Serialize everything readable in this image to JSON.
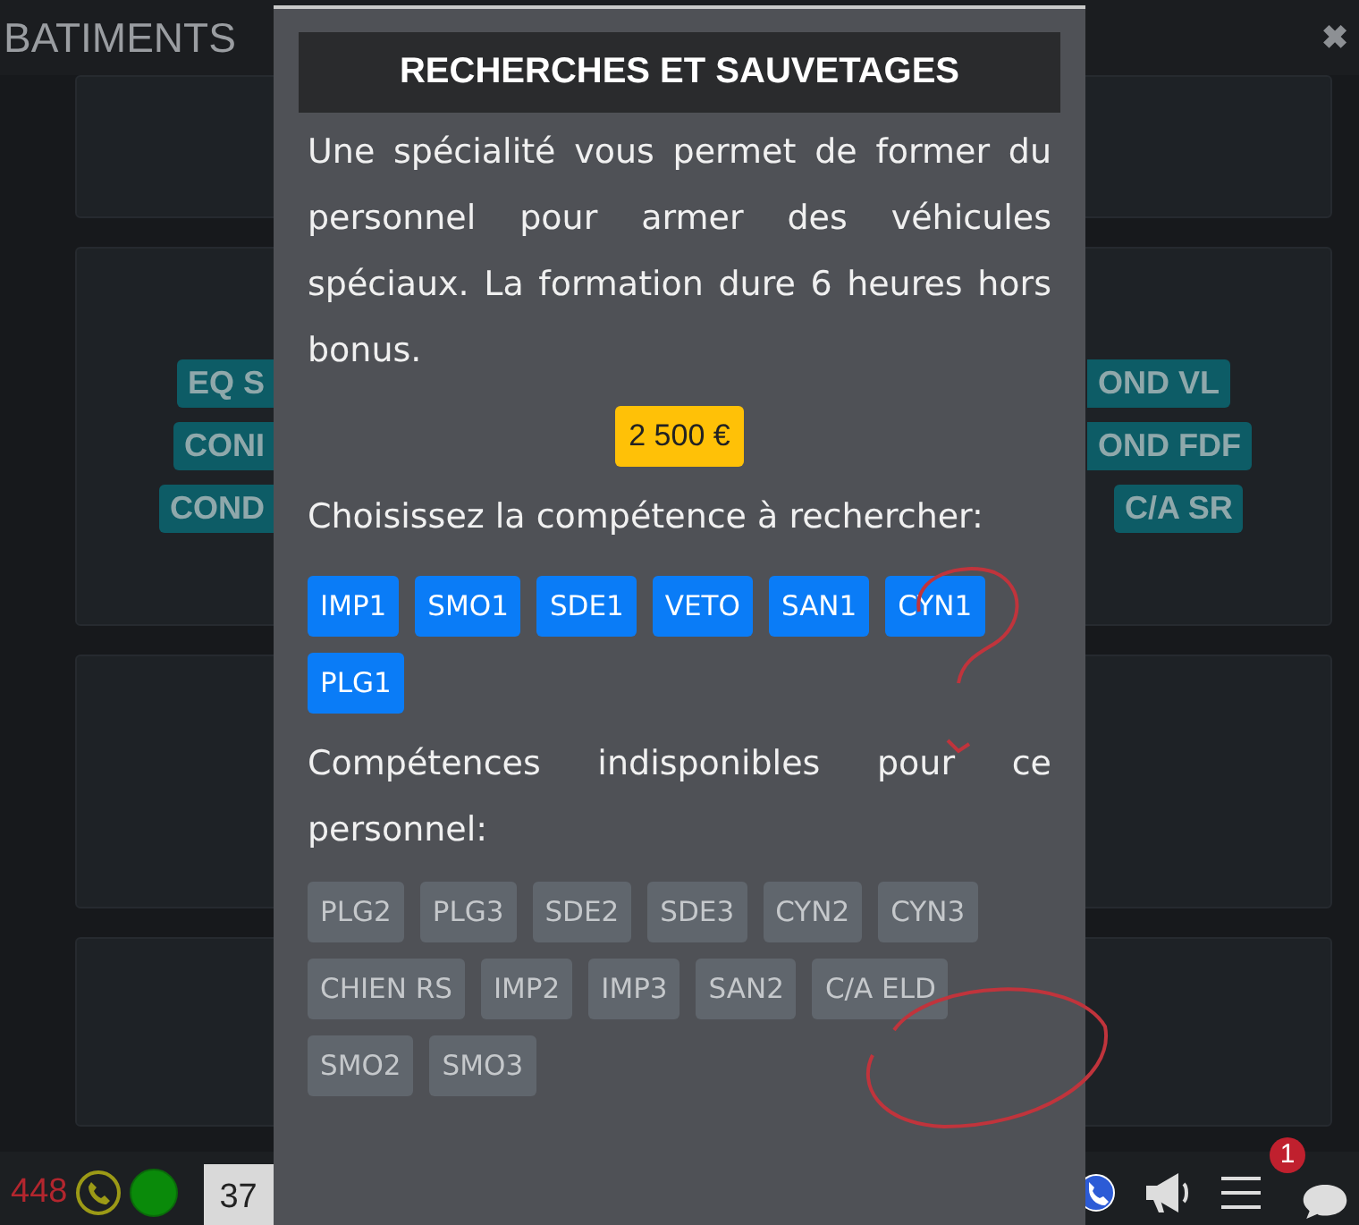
{
  "header": {
    "title": "BATIMENTS",
    "close": "✖"
  },
  "background_tags": {
    "left": [
      "EQ S",
      "CONI",
      "COND"
    ],
    "right": [
      "OND VL",
      "OND FDF",
      "C/A SR"
    ]
  },
  "modal": {
    "title": "RECHERCHES ET SAUVETAGES",
    "description": "Une spécialité vous permet de former du personnel pour armer des véhicules spéciaux. La formation dure 6 heures hors bonus.",
    "price": "2 500 €",
    "prompt": "Choisissez la compétence à rechercher:",
    "available": [
      "IMP1",
      "SMO1",
      "SDE1",
      "VETO",
      "SAN1",
      "CYN1",
      "PLG1"
    ],
    "unavailable_label": "Compétences indisponibles pour ce personnel:",
    "unavailable": [
      "PLG2",
      "PLG3",
      "SDE2",
      "SDE3",
      "CYN2",
      "CYN3",
      "CHIEN RS",
      "IMP2",
      "IMP3",
      "SAN2",
      "C/A ELD",
      "SMO2",
      "SMO3"
    ]
  },
  "status_bar": {
    "count": "448",
    "counter": "37",
    "notifications": "1"
  }
}
